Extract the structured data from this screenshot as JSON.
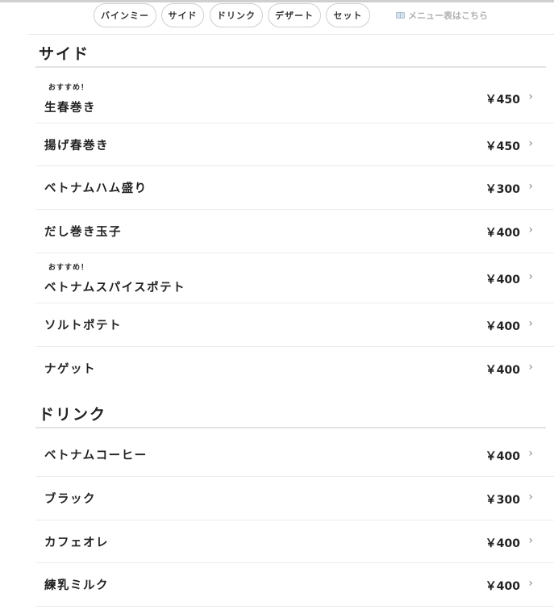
{
  "nav": {
    "chips": [
      "バインミー",
      "サイド",
      "ドリンク",
      "デザート",
      "セット"
    ],
    "menu_link": "メニュー表はこちら"
  },
  "sections": [
    {
      "title": "サイド",
      "items": [
        {
          "badge": "おすすめ！",
          "name": "生春巻き",
          "price": "￥450"
        },
        {
          "badge": "",
          "name": "揚げ春巻き",
          "price": "￥450"
        },
        {
          "badge": "",
          "name": "ベトナムハム盛り",
          "price": "￥300"
        },
        {
          "badge": "",
          "name": "だし巻き玉子",
          "price": "￥400"
        },
        {
          "badge": "おすすめ！",
          "name": "ベトナムスパイスポテト",
          "price": "￥400"
        },
        {
          "badge": "",
          "name": "ソルトポテト",
          "price": "￥400"
        },
        {
          "badge": "",
          "name": "ナゲット",
          "price": "￥400"
        }
      ]
    },
    {
      "title": "ドリンク",
      "items": [
        {
          "badge": "",
          "name": "ベトナムコーヒー",
          "price": "￥400"
        },
        {
          "badge": "",
          "name": "ブラック",
          "price": "￥300"
        },
        {
          "badge": "",
          "name": "カフェオレ",
          "price": "￥400"
        },
        {
          "badge": "",
          "name": "練乳ミルク",
          "price": "￥400"
        }
      ]
    }
  ],
  "chevron": "›"
}
